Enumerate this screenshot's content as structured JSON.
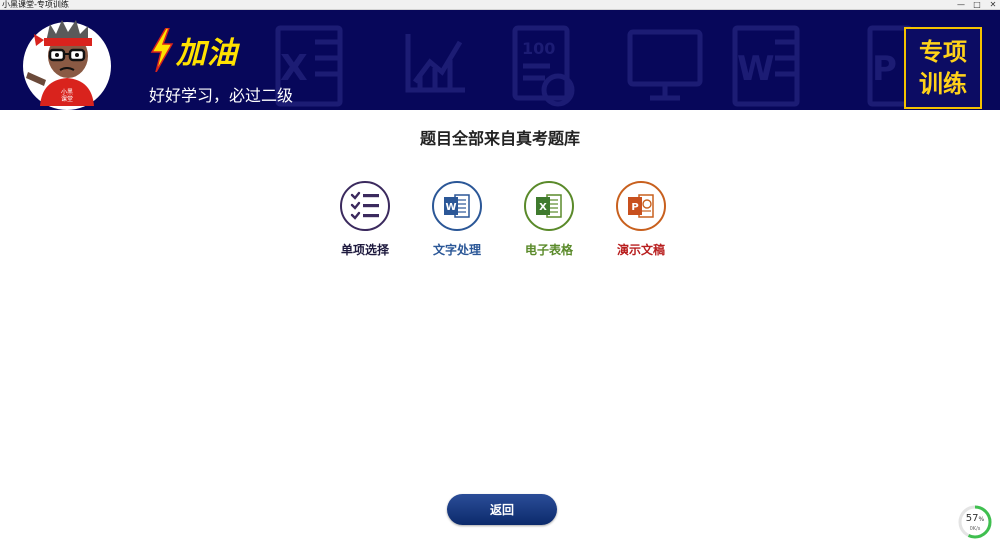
{
  "window": {
    "title": "小黑课堂-专项训练",
    "controls": [
      "—",
      "□",
      "✕"
    ]
  },
  "banner": {
    "mascot_badge": "小黑\n课堂",
    "slogan_main": "加油",
    "slogan_sub": "好好学习，必过二级",
    "badge_line1": "专项",
    "badge_line2": "训练",
    "colors": {
      "background": "#07075a",
      "accent": "#ffe100"
    }
  },
  "main": {
    "heading": "题目全部来自真考题库",
    "modules": [
      {
        "label": "单项选择",
        "icon": "checklist-icon",
        "color": "#3b2a5e"
      },
      {
        "label": "文字处理",
        "icon": "word-icon",
        "color": "#2b5797"
      },
      {
        "label": "电子表格",
        "icon": "excel-icon",
        "color": "#5a8a2a"
      },
      {
        "label": "演示文稿",
        "icon": "powerpoint-icon",
        "color": "#c0392b"
      }
    ],
    "back_label": "返回"
  },
  "meter": {
    "percent": "57",
    "percent_unit": "%",
    "rate": "0K/s"
  }
}
